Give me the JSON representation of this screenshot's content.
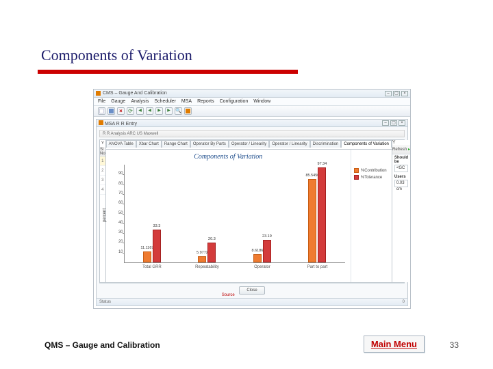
{
  "slide": {
    "title": "Components of Variation",
    "footer": "QMS – Gauge and Calibration",
    "main_menu": "Main Menu",
    "page_number": "33"
  },
  "app": {
    "title": "CMS – Gauge And Calibration",
    "menu": [
      "File",
      "Gauge",
      "Analysis",
      "Scheduler",
      "MSA",
      "Reports",
      "Configuration",
      "Window"
    ],
    "sub_window_title": "MSA R R Entry",
    "sub_header": "R R Analysis  ARC US Maxwell",
    "tabs": [
      "ANOVA Table",
      "Xbar Chart",
      "Range Chart",
      "Operator By Parts",
      "Operator / Linearity",
      "Operator / Linearity",
      "Discrimination",
      "Components of Variation"
    ],
    "active_tab": 7,
    "left_header": "Sl No",
    "left_y": "Y",
    "left_rows": [
      "1",
      "2",
      "3",
      "4"
    ],
    "right_header": "Y",
    "right_refresh": "Refresh",
    "field1_label": "Should be",
    "field1_value": "<GC",
    "field2_label": "Users",
    "field2_value": "0.03 cm",
    "close_btn": "Close",
    "status_left": "Status",
    "status_right": "0"
  },
  "chart_data": {
    "type": "bar",
    "title": "Components of Variation",
    "ylabel": "percent",
    "xlabel": "Source",
    "ylim": [
      0,
      100
    ],
    "ticks": [
      10,
      20,
      30,
      40,
      50,
      60,
      70,
      80,
      90
    ],
    "categories": [
      "Total GRR",
      "Repeatability",
      "Operator",
      "Part to part"
    ],
    "series": [
      {
        "name": "%Contribution",
        "color": "orange",
        "values": [
          11.1167,
          5.9772,
          8.6186,
          85.5456
        ]
      },
      {
        "name": "%Tolerance",
        "color": "red",
        "values": [
          33.3,
          20.3,
          23.19,
          97.34
        ]
      }
    ],
    "value_labels": [
      [
        "11.1167",
        "5.9772",
        "8.6186",
        "85.5456"
      ],
      [
        "33.3",
        "20.3",
        "23.19",
        "97.34"
      ]
    ]
  }
}
